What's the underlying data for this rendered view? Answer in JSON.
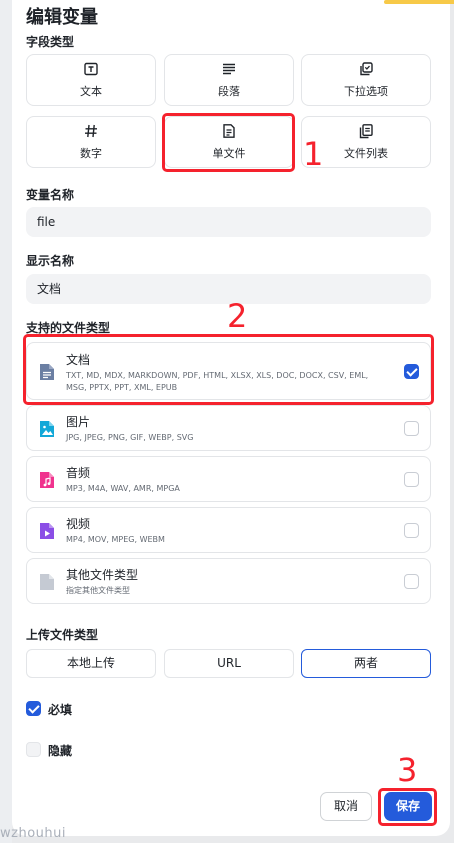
{
  "dialog": {
    "title": "编辑变量",
    "field_type_label": "字段类型",
    "field_types": [
      {
        "label": "文本",
        "icon": "text-box-icon"
      },
      {
        "label": "段落",
        "icon": "paragraph-icon"
      },
      {
        "label": "下拉选项",
        "icon": "select-icon"
      },
      {
        "label": "数字",
        "icon": "hash-icon"
      },
      {
        "label": "单文件",
        "icon": "file-icon"
      },
      {
        "label": "文件列表",
        "icon": "file-list-icon"
      }
    ],
    "var_name_label": "变量名称",
    "var_name_value": "file",
    "display_name_label": "显示名称",
    "display_name_value": "文档",
    "supported_types_label": "支持的文件类型",
    "file_types": [
      {
        "name": "文档",
        "desc": "TXT, MD, MDX, MARKDOWN, PDF, HTML, XLSX, XLS, DOC, DOCX, CSV, EML, MSG, PPTX, PPT, XML, EPUB",
        "checked": true,
        "color": "#6b7fa3"
      },
      {
        "name": "图片",
        "desc": "JPG, JPEG, PNG, GIF, WEBP, SVG",
        "checked": false,
        "color": "#13a8d8"
      },
      {
        "name": "音频",
        "desc": "MP3, M4A, WAV, AMR, MPGA",
        "checked": false,
        "color": "#f0338e"
      },
      {
        "name": "视频",
        "desc": "MP4, MOV, MPEG, WEBM",
        "checked": false,
        "color": "#8b4ee6"
      },
      {
        "name": "其他文件类型",
        "desc": "指定其他文件类型",
        "checked": false,
        "color": "#c5cad3"
      }
    ],
    "upload_label": "上传文件类型",
    "upload_options": [
      "本地上传",
      "URL",
      "两者"
    ],
    "upload_selected": "两者",
    "required_label": "必填",
    "hidden_label": "隐藏",
    "cancel_label": "取消",
    "save_label": "保存"
  },
  "annotations": [
    "1",
    "2",
    "3"
  ],
  "watermark": "wzhouhui",
  "colors": {
    "primary": "#245bdb",
    "annotation": "#f5222d",
    "accent": "#f7c948"
  }
}
